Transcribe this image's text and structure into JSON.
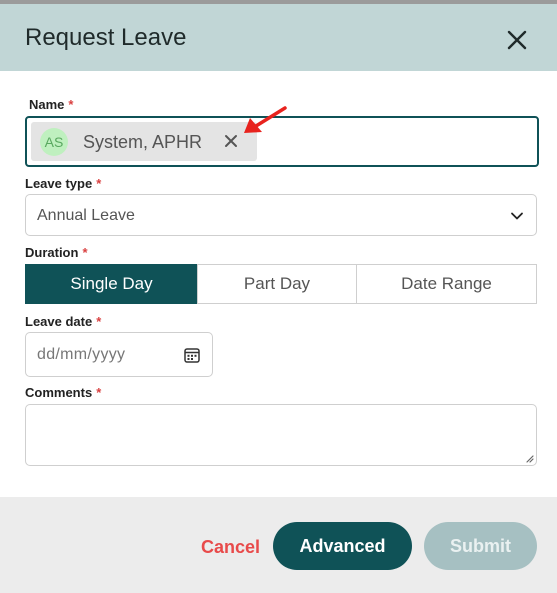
{
  "dialog": {
    "title": "Request Leave"
  },
  "form": {
    "name": {
      "label": "Name",
      "required_mark": "*",
      "chip_initials": "AS",
      "chip_text": "System, APHR"
    },
    "leave_type": {
      "label": "Leave type",
      "required_mark": "*",
      "value": "Annual Leave"
    },
    "duration": {
      "label": "Duration",
      "required_mark": "*",
      "options": [
        "Single Day",
        "Part Day",
        "Date Range"
      ],
      "selected": "Single Day"
    },
    "leave_date": {
      "label": "Leave date",
      "required_mark": "*",
      "placeholder": "dd/mm/yyyy"
    },
    "comments": {
      "label": "Comments",
      "required_mark": "*"
    }
  },
  "footer": {
    "cancel_label": "Cancel",
    "advanced_label": "Advanced",
    "submit_label": "Submit"
  },
  "icons": {
    "close": "close-icon",
    "chip_remove": "remove-chip-icon",
    "dropdown": "chevron-down-icon",
    "calendar": "calendar-icon",
    "resize": "resize-grip-icon",
    "annotation": "red-arrow-annotation"
  },
  "colors": {
    "header_bg": "#c1d6d6",
    "primary": "#0f5257",
    "danger": "#e84a4a",
    "required": "#d94040",
    "disabled_button": "#a6c0c2",
    "avatar_bg": "#bff0bf",
    "annotation": "#e8231e"
  }
}
